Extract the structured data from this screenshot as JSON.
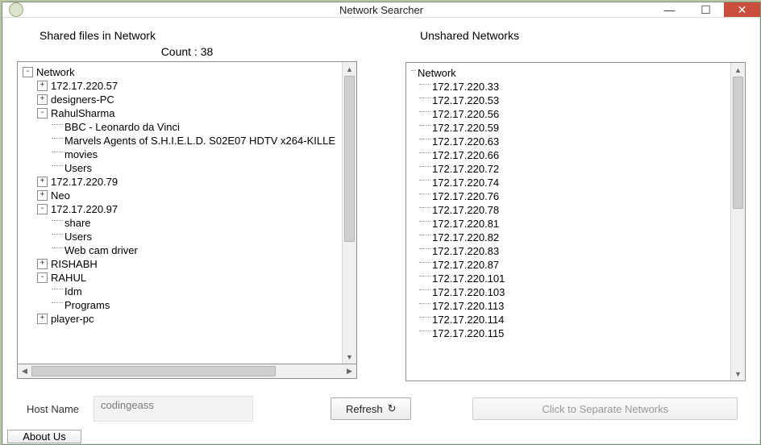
{
  "window": {
    "title": "Network Searcher"
  },
  "left": {
    "title": "Shared files in Network",
    "count_label": "Count : 38",
    "root": "Network",
    "nodes": [
      {
        "exp": "+",
        "depth": 1,
        "label": "172.17.220.57"
      },
      {
        "exp": "+",
        "depth": 1,
        "label": "designers-PC"
      },
      {
        "exp": "-",
        "depth": 1,
        "label": "RahulSharma"
      },
      {
        "exp": "",
        "depth": 2,
        "label": "BBC - Leonardo da Vinci"
      },
      {
        "exp": "",
        "depth": 2,
        "label": "Marvels Agents of S.H.I.E.L.D. S02E07 HDTV x264-KILLE"
      },
      {
        "exp": "",
        "depth": 2,
        "label": "movies"
      },
      {
        "exp": "",
        "depth": 2,
        "label": "Users"
      },
      {
        "exp": "+",
        "depth": 1,
        "label": "172.17.220.79"
      },
      {
        "exp": "+",
        "depth": 1,
        "label": "Neo"
      },
      {
        "exp": "-",
        "depth": 1,
        "label": "172.17.220.97"
      },
      {
        "exp": "",
        "depth": 2,
        "label": "share"
      },
      {
        "exp": "",
        "depth": 2,
        "label": "Users"
      },
      {
        "exp": "",
        "depth": 2,
        "label": "Web cam driver"
      },
      {
        "exp": "+",
        "depth": 1,
        "label": "RISHABH"
      },
      {
        "exp": "-",
        "depth": 1,
        "label": "RAHUL"
      },
      {
        "exp": "",
        "depth": 2,
        "label": "Idm"
      },
      {
        "exp": "",
        "depth": 2,
        "label": "Programs"
      },
      {
        "exp": "+",
        "depth": 1,
        "label": "player-pc"
      }
    ]
  },
  "right": {
    "title": "Unshared  Networks",
    "root": "Network",
    "items": [
      "172.17.220.33",
      "172.17.220.53",
      "172.17.220.56",
      "172.17.220.59",
      "172.17.220.63",
      "172.17.220.66",
      "172.17.220.72",
      "172.17.220.74",
      "172.17.220.76",
      "172.17.220.78",
      "172.17.220.81",
      "172.17.220.82",
      "172.17.220.83",
      "172.17.220.87",
      "172.17.220.101",
      "172.17.220.103",
      "172.17.220.113",
      "172.17.220.114",
      "172.17.220.115"
    ]
  },
  "footer": {
    "hostname_label": "Host Name",
    "hostname_value": "codingeass",
    "refresh": "Refresh",
    "separate": "Click to Separate Networks",
    "about": "About Us"
  }
}
